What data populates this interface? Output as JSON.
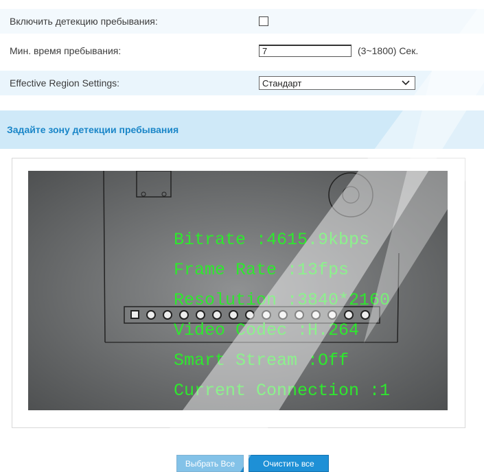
{
  "settings": {
    "enable_label": "Включить детекцию пребывания:",
    "enable_checked": false,
    "min_time_label": "Мин. время пребывания:",
    "min_time_value": "7",
    "min_time_range": "(3~1800) Сек.",
    "region_label": "Effective Region Settings:",
    "region_value": "Стандарт"
  },
  "section": {
    "title": "Задайте зону детекции пребывания"
  },
  "video": {
    "osd": [
      "Bitrate :4615.9kbps",
      "Frame Rate :13fps",
      "Resolution :3840*2160",
      "Video Codec :H.264",
      "Smart Stream :Off",
      "Current Connection :1"
    ],
    "osd_color": "#2ee82e"
  },
  "buttons": {
    "select_all": "Выбрать Все",
    "clear_all": "Очистить все"
  },
  "colors": {
    "accent": "#1a86c8",
    "button": "#1e90d6",
    "header_bg": "#cfe9f8"
  }
}
